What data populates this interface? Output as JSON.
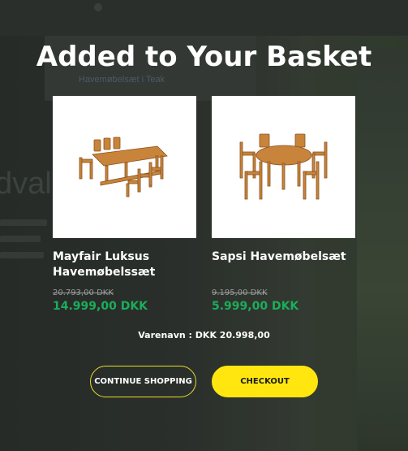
{
  "background": {
    "breadcrumb": "Havemøbelsæt i Teak",
    "hero_fragment": "dval"
  },
  "modal": {
    "title": "Added to Your Basket",
    "products": [
      {
        "name": "Mayfair Luksus Havemøbelssæt",
        "old_price": "20.793,00 DKK",
        "price": "14.999,00 DKK",
        "image_icon": "rectangular-teak-dining-set-icon"
      },
      {
        "name": "Sapsi Havemøbelsæt",
        "old_price": "9.195,00 DKK",
        "price": "5.999,00 DKK",
        "image_icon": "round-teak-dining-set-icon"
      }
    ],
    "total": "Varenavn : DKK 20.998,00",
    "continue_label": "CONTINUE SHOPPING",
    "checkout_label": "CHECKOUT"
  },
  "colors": {
    "overlay": "#1f2321",
    "price_green": "#1bae5a",
    "accent_yellow": "#ffe60f",
    "teak": "#c8843a"
  }
}
